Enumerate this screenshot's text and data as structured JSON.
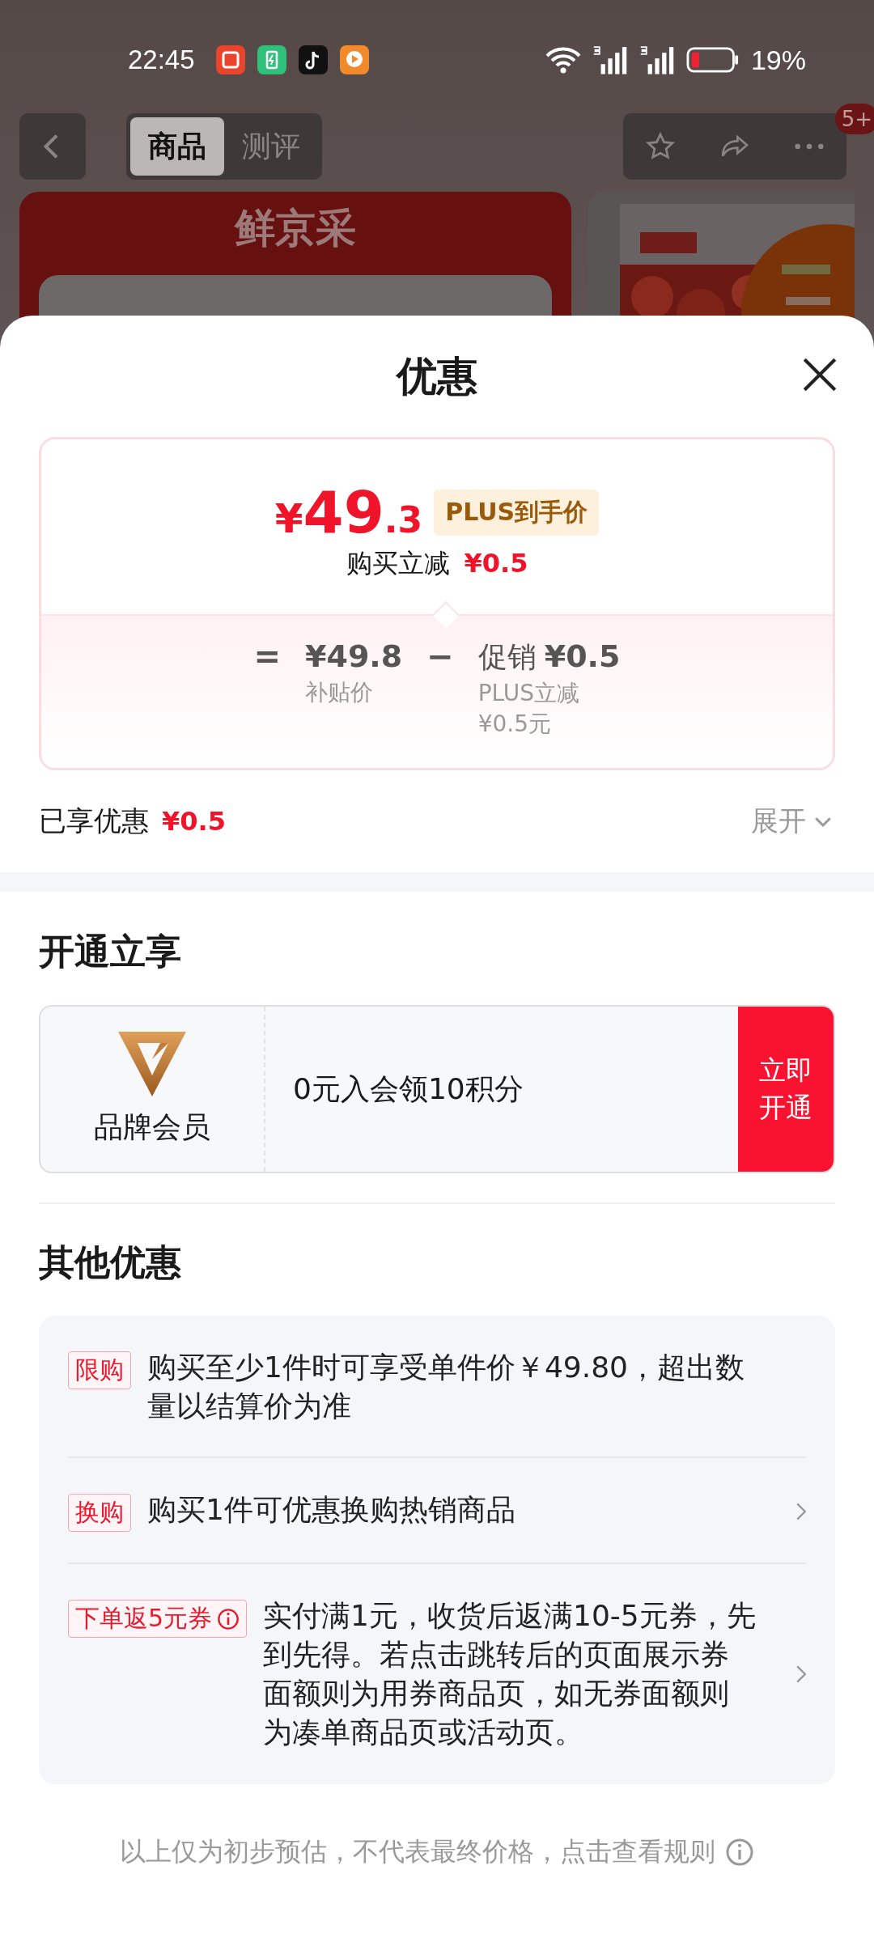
{
  "status_bar": {
    "time": "22:45",
    "battery": "19%"
  },
  "nav": {
    "tabs": [
      {
        "label": "商品",
        "selected": true
      },
      {
        "label": "测评",
        "selected": false
      }
    ],
    "badge": "5+"
  },
  "background": {
    "banner_title": "鲜京采"
  },
  "sheet": {
    "title": "优惠",
    "price": {
      "currency": "¥",
      "integer": "49",
      "decimal": ".3",
      "tag": "PLUS到手价",
      "cut_label": "购买立减",
      "cut_amount": "¥0.5"
    },
    "formula": [
      {
        "kind": "operator",
        "symbol": "="
      },
      {
        "kind": "term",
        "amount": "¥49.8",
        "captions": [
          "补贴价"
        ]
      },
      {
        "kind": "operator",
        "symbol": "−"
      },
      {
        "kind": "term",
        "label": "促销",
        "amount": "¥0.5",
        "captions": [
          "PLUS立减",
          "¥0.5元"
        ]
      }
    ],
    "enjoyed": {
      "label": "已享优惠",
      "amount": "¥0.5",
      "toggle": "展开"
    },
    "open_section": {
      "heading": "开通立享",
      "card": {
        "name": "品牌会员",
        "offer": "0元入会领10积分",
        "button": "立即开通"
      }
    },
    "other": {
      "heading": "其他优惠",
      "items": [
        {
          "tag": "限购",
          "info": false,
          "text": "购买至少1件时可享受单件价￥49.80，超出数量以结算价为准",
          "arrow": false
        },
        {
          "tag": "换购",
          "info": false,
          "text": "购买1件可优惠换购热销商品",
          "arrow": true
        },
        {
          "tag": "下单返5元券",
          "info": true,
          "text": "实付满1元，收货后返满10-5元券，先到先得。若点击跳转后的页面展示券面额则为用券商品页，如无券面额则为凑单商品页或活动页。",
          "arrow": true
        }
      ]
    },
    "footer": "以上仅为初步预估，不代表最终价格，点击查看规则"
  }
}
